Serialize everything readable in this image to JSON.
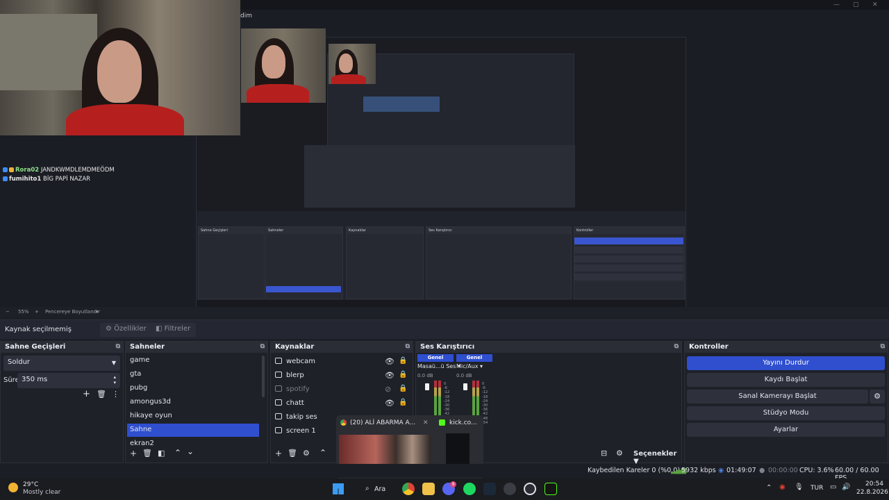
{
  "window": {
    "title_fragment": "dim"
  },
  "chat": [
    {
      "user": "Rora02",
      "message": "JANDKWMDLEMDMEÖDM"
    },
    {
      "user": "fumihito1",
      "message": "BİG PAPİ NAZAR"
    }
  ],
  "preview_bar": {
    "zoom": "55%",
    "mode": "Pencereye Boyutlandır"
  },
  "properties_bar": {
    "no_source": "Kaynak seçilmemiş",
    "properties_button": "Özellikler",
    "filters_button": "Filtreler"
  },
  "transitions": {
    "title": "Sahne Geçişleri",
    "selected": "Soldur",
    "duration_label": "Süre",
    "duration_value": "350 ms"
  },
  "scenes": {
    "title": "Sahneler",
    "items": [
      "game",
      "gta",
      "pubg",
      "amongus3d",
      "hikaye oyun",
      "Sahne",
      "ekran2"
    ],
    "selected": "Sahne"
  },
  "sources": {
    "title": "Kaynaklar",
    "items": [
      "webcam",
      "blerp",
      "spotify",
      "chatt",
      "takip ses",
      "screen 1"
    ]
  },
  "mixer": {
    "title": "Ses Karıştırıcı",
    "channels": [
      {
        "group": "Genel",
        "name": "Masaü...ü Ses",
        "db": "0.0 dB"
      },
      {
        "group": "Genel",
        "name": "Mic/Aux",
        "db": "0.0 dB"
      }
    ],
    "scale": [
      "0",
      "-6",
      "-12",
      "-18",
      "-24",
      "-30",
      "-36",
      "-42",
      "-48",
      "-54"
    ],
    "options": "Seçenekler"
  },
  "controls": {
    "title": "Kontroller",
    "stop_stream": "Yayını Durdur",
    "start_record": "Kaydı Başlat",
    "virtual_cam": "Sanal Kamerayı Başlat",
    "studio_mode": "Stüdyo Modu",
    "settings": "Ayarlar"
  },
  "taskbar_popup": {
    "tab1": "(20) ALİ ABARMA A...",
    "tab2": "kick.co..."
  },
  "status": {
    "dropped": "Kaybedilen Kareler 0 (%0.0)",
    "bitrate": "5932 kbps",
    "live_time": "01:49:07",
    "rec_time": "00:00:00",
    "cpu": "CPU: 3.6%",
    "fps": "60.00 / 60.00 FPS"
  },
  "taskbar": {
    "weather_temp": "29°C",
    "weather_desc": "Mostly clear",
    "search": "Ara",
    "lang": "TUR",
    "time": "20:54",
    "date": "22.8.2026",
    "discord_badge": "9"
  },
  "colors": {
    "accent": "#2f4fcf",
    "meter_green": "#5aa33f",
    "meter_yellow": "#b7a34a",
    "meter_red": "#b5313c"
  }
}
